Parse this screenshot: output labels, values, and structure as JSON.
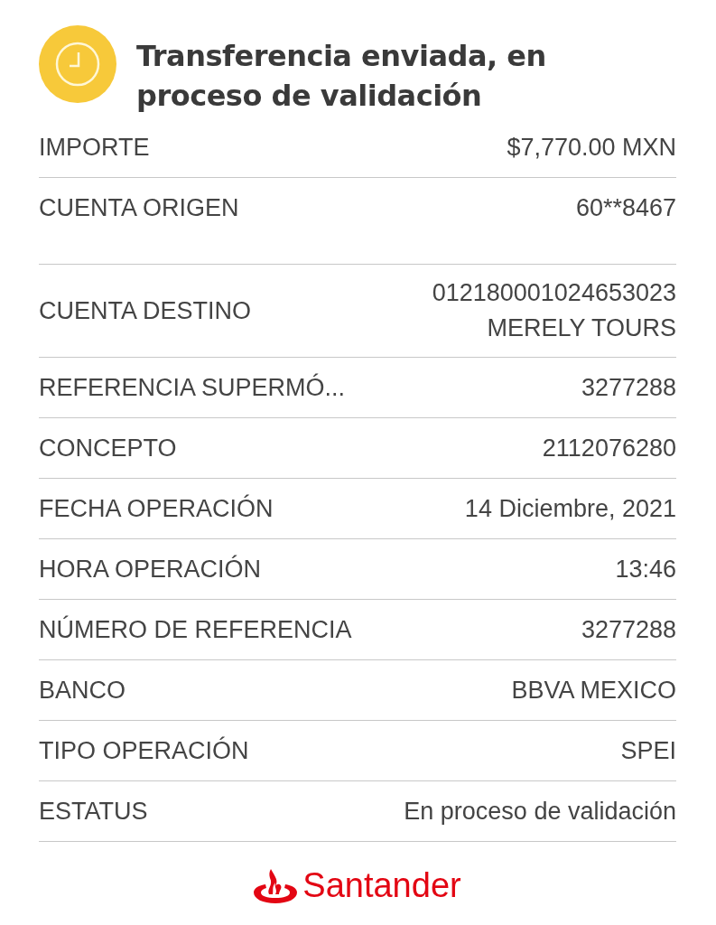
{
  "header": {
    "title": "Transferencia enviada, en proceso de validación"
  },
  "rows": [
    {
      "label": "IMPORTE",
      "values": [
        "$7,770.00 MXN"
      ]
    },
    {
      "label": "CUENTA ORIGEN",
      "values": [
        "60**8467"
      ]
    },
    {
      "label": "CUENTA DESTINO",
      "values": [
        "012180001024653023",
        "MERELY TOURS"
      ]
    },
    {
      "label": "REFERENCIA SUPERMÓ...",
      "values": [
        "3277288"
      ]
    },
    {
      "label": "CONCEPTO",
      "values": [
        "2112076280"
      ]
    },
    {
      "label": "FECHA OPERACIÓN",
      "values": [
        "14 Diciembre, 2021"
      ]
    },
    {
      "label": "HORA OPERACIÓN",
      "values": [
        "13:46"
      ]
    },
    {
      "label": "NÚMERO DE REFERENCIA",
      "values": [
        "3277288"
      ]
    },
    {
      "label": "BANCO",
      "values": [
        "BBVA MEXICO"
      ]
    },
    {
      "label": "TIPO OPERACIÓN",
      "values": [
        "SPEI"
      ]
    },
    {
      "label": "ESTATUS",
      "values": [
        "En proceso de validación"
      ]
    }
  ],
  "footer": {
    "brand": "Santander"
  }
}
